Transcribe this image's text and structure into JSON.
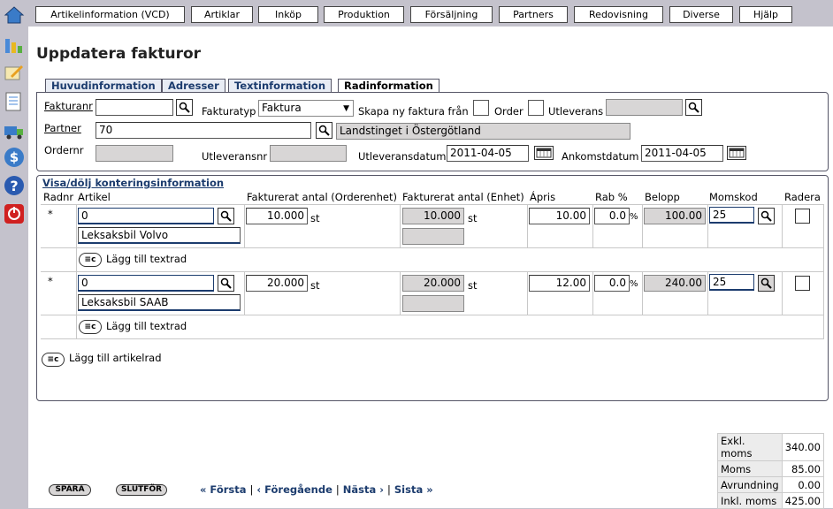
{
  "menu": [
    "Artikelinformation (VCD)",
    "Artiklar",
    "Inköp",
    "Produktion",
    "Försäljning",
    "Partners",
    "Redovisning",
    "Diverse",
    "Hjälp"
  ],
  "sidebar_icons": [
    "home-icon",
    "chart-icon",
    "edit-icon",
    "notes-icon",
    "truck-icon",
    "dollar-icon",
    "help-icon",
    "power-icon"
  ],
  "page": {
    "title": "Uppdatera fakturor"
  },
  "tabs": [
    "Huvudinformation",
    "Adresser",
    "Textinformation",
    "Radinformation"
  ],
  "form": {
    "fakturanr_label": "Fakturanr",
    "fakturanr_value": "",
    "fakturatyp_label": "Fakturatyp",
    "fakturatyp_value": "Faktura",
    "skapa_label": "Skapa ny faktura från",
    "order_label": "Order",
    "utleverans_label": "Utleverans",
    "utleverans_value": "",
    "partner_label": "Partner",
    "partner_value": "70",
    "partner_name": "Landstinget i Östergötland",
    "ordernr_label": "Ordernr",
    "ordernr_value": "",
    "utleveransnr_label": "Utleveransnr",
    "utleveransnr_value": "",
    "utleveransdatum_label": "Utleveransdatum",
    "utleveransdatum_value": "2011-04-05",
    "ankomstdatum_label": "Ankomstdatum",
    "ankomstdatum_value": "2011-04-05"
  },
  "rows_section": {
    "toggle_link": "Visa/dölj konteringsinformation",
    "headers": [
      "Radnr",
      "Artikel",
      "Fakturerat antal (Orderenhet)",
      "Fakturerat antal (Enhet)",
      "Ápris",
      "Rab %",
      "Belopp",
      "Momskod",
      "Radera"
    ],
    "rows": [
      {
        "radnr": "*",
        "artikel": "0",
        "benamning": "Leksaksbil Volvo",
        "antal_order": "10.000",
        "enhet_order": "st",
        "antal_enhet": "10.000",
        "enhet": "st",
        "apris": "10.00",
        "rabatt": "0.0",
        "rab_unit": "%",
        "belopp": "100.00",
        "momskod": "25",
        "add_text": "Lägg till textrad"
      },
      {
        "radnr": "*",
        "artikel": "0",
        "benamning": "Leksaksbil SAAB",
        "antal_order": "20.000",
        "enhet_order": "st",
        "antal_enhet": "20.000",
        "enhet": "st",
        "apris": "12.00",
        "rabatt": "0.0",
        "rab_unit": "%",
        "belopp": "240.00",
        "momskod": "25",
        "add_text": "Lägg till textrad"
      }
    ],
    "add_article": "Lägg till artikelrad"
  },
  "summary": [
    {
      "label": "Exkl. moms",
      "value": "340.00"
    },
    {
      "label": "Moms",
      "value": "85.00"
    },
    {
      "label": "Avrundning",
      "value": "0.00"
    },
    {
      "label": "Inkl. moms",
      "value": "425.00"
    }
  ],
  "buttons": {
    "spara": "SPARA",
    "slutfor": "SLUTFÖR"
  },
  "pager": {
    "first": "« Första",
    "prev": "‹ Föregående",
    "next": "Nästa ›",
    "last": "Sista »"
  }
}
